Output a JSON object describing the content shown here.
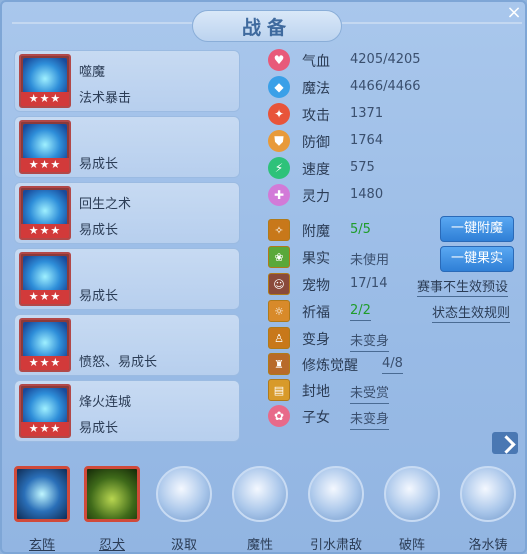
{
  "title": "战备",
  "skills": [
    {
      "name": "噬魔",
      "sub": "法术暴击",
      "stars": "★★★"
    },
    {
      "name": "",
      "sub": "易成长",
      "stars": "★★★"
    },
    {
      "name": "回生之术",
      "sub": "易成长",
      "stars": "★★★"
    },
    {
      "name": "",
      "sub": "易成长",
      "stars": "★★★"
    },
    {
      "name": "",
      "sub": "愤怒、易成长",
      "stars": "★★★"
    },
    {
      "name": "烽火连城",
      "sub": "易成长",
      "stars": "★★★"
    }
  ],
  "stats": [
    {
      "label": "气血",
      "value": "4205/4205",
      "icon": "heart-icon",
      "color": "#e85a7a"
    },
    {
      "label": "魔法",
      "value": "4466/4466",
      "icon": "mana-icon",
      "color": "#3aa0e8"
    },
    {
      "label": "攻击",
      "value": "1371",
      "icon": "attack-icon",
      "color": "#e8543a"
    },
    {
      "label": "防御",
      "value": "1764",
      "icon": "shield-icon",
      "color": "#e89a3a"
    },
    {
      "label": "速度",
      "value": "575",
      "icon": "speed-icon",
      "color": "#2ec27a"
    },
    {
      "label": "灵力",
      "value": "1480",
      "icon": "spirit-icon",
      "color": "#d27ad8"
    }
  ],
  "extras": [
    {
      "label": "附魔",
      "value": "5/5",
      "icon": "enchant-icon",
      "color": "#c8781a"
    },
    {
      "label": "果实",
      "value": "未使用",
      "icon": "fruit-icon",
      "color": "#5aa83a"
    },
    {
      "label": "宠物",
      "value": "17/14",
      "icon": "pet-icon",
      "color": "#8a4a3a"
    },
    {
      "label": "祈福",
      "value": "2/2",
      "icon": "blessing-icon",
      "color": "#d88a2a"
    },
    {
      "label": "变身",
      "value": "未变身",
      "icon": "transform-icon",
      "color": "#c8781a"
    },
    {
      "label": "修炼觉醒",
      "value": "4/8",
      "icon": "cultivation-icon",
      "color": "#b86a2a"
    },
    {
      "label": "封地",
      "value": "未受赏",
      "icon": "fief-icon",
      "color": "#d89a2a"
    },
    {
      "label": "子女",
      "value": "未变身",
      "icon": "child-icon",
      "color": "#e86a8a"
    }
  ],
  "buttons": {
    "enchant": "一键附魔",
    "fruit": "一键果实"
  },
  "links": {
    "preset": "赛事不生效预设",
    "rule": "状态生效规则"
  },
  "formations": [
    {
      "label": "玄阵"
    },
    {
      "label": "忍犬"
    },
    {
      "label": "汲取"
    },
    {
      "label": "魔性"
    },
    {
      "label": "引水肃敌"
    },
    {
      "label": "破阵"
    },
    {
      "label": "洛水铸"
    }
  ],
  "colors": {
    "accent": "#2f7fd6",
    "panel": "#b7cfee",
    "green": "#1f9c2a"
  }
}
